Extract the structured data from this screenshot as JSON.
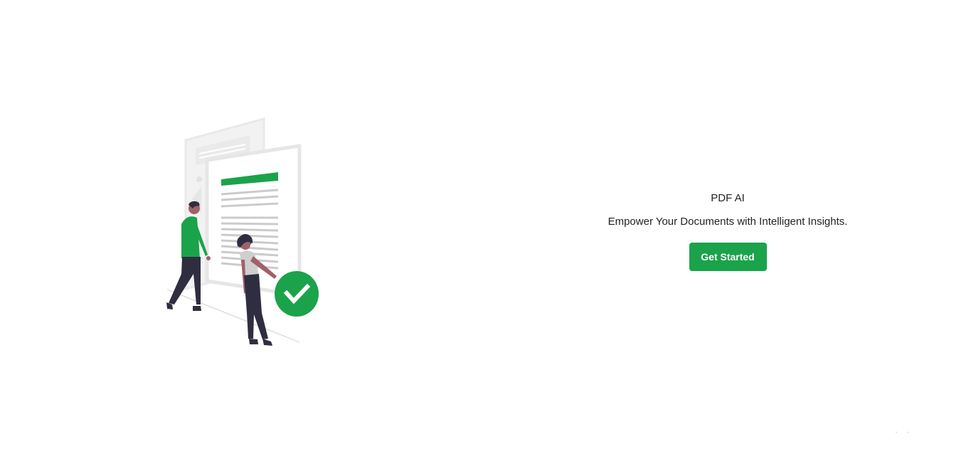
{
  "hero": {
    "app_title": "PDF AI",
    "tagline": "Empower Your Documents with Intelligent Insights.",
    "cta_label": "Get Started"
  },
  "illustration": {
    "icon": "documents-checkmark-illustration"
  },
  "colors": {
    "accent": "#1aa34a",
    "text": "#222222",
    "background": "#ffffff",
    "document_gray": "#e8e8e8",
    "figure_dark": "#2f2e41"
  }
}
